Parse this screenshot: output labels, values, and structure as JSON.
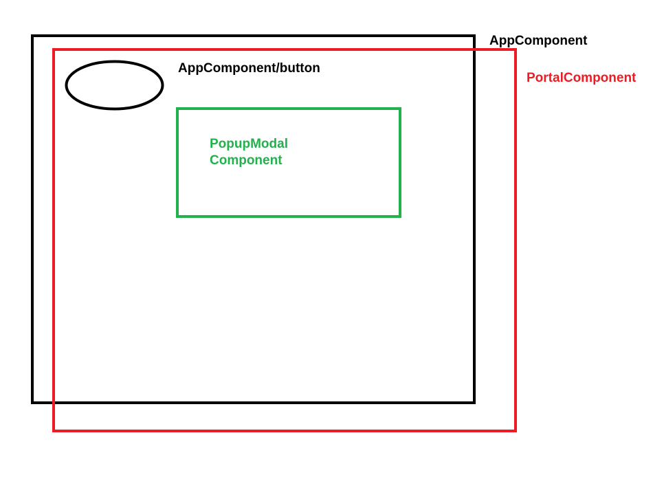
{
  "labels": {
    "app_component": "AppComponent",
    "portal_component": "PortalComponent",
    "app_button": "AppComponent/button",
    "popup_modal_line1": "PopupModal",
    "popup_modal_line2": "Component"
  },
  "colors": {
    "app": "#000000",
    "portal": "#ed1c24",
    "modal": "#22b14c",
    "background": "#ffffff"
  }
}
